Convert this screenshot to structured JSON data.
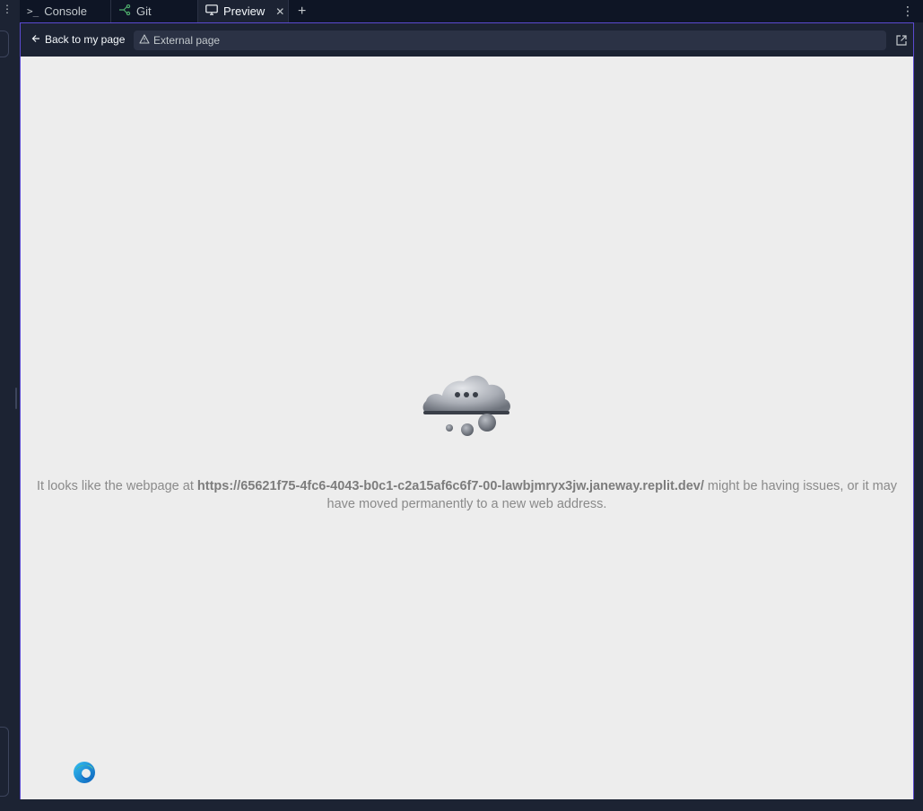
{
  "tabs": [
    {
      "label": "Console",
      "icon": "terminal-icon"
    },
    {
      "label": "Git",
      "icon": "git-branch-icon"
    },
    {
      "label": "Preview",
      "icon": "monitor-icon",
      "active": true
    }
  ],
  "url_bar": {
    "back_label": "Back to my page",
    "external_label": "External page"
  },
  "error": {
    "prefix": "It looks like the webpage at ",
    "url": "https://65621f75-4fc6-4043-b0c1-c2a15af6c6f7-00-lawbjmryx3jw.janeway.replit.dev/",
    "suffix": " might be having issues, or it may have moved permanently to a new web address."
  },
  "colors": {
    "accent_border": "#5b4ad1",
    "content_bg": "#ededed",
    "git_icon": "#4fb06d"
  }
}
